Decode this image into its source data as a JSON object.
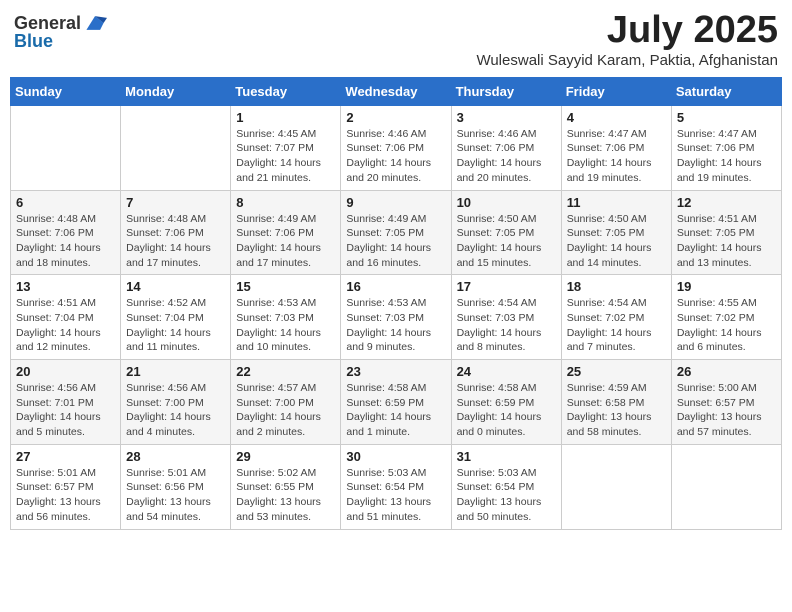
{
  "header": {
    "logo_general": "General",
    "logo_blue": "Blue",
    "title": "July 2025",
    "location": "Wuleswali Sayyid Karam, Paktia, Afghanistan"
  },
  "days_of_week": [
    "Sunday",
    "Monday",
    "Tuesday",
    "Wednesday",
    "Thursday",
    "Friday",
    "Saturday"
  ],
  "weeks": [
    [
      {
        "day": "",
        "detail": ""
      },
      {
        "day": "",
        "detail": ""
      },
      {
        "day": "1",
        "detail": "Sunrise: 4:45 AM\nSunset: 7:07 PM\nDaylight: 14 hours and 21 minutes."
      },
      {
        "day": "2",
        "detail": "Sunrise: 4:46 AM\nSunset: 7:06 PM\nDaylight: 14 hours and 20 minutes."
      },
      {
        "day": "3",
        "detail": "Sunrise: 4:46 AM\nSunset: 7:06 PM\nDaylight: 14 hours and 20 minutes."
      },
      {
        "day": "4",
        "detail": "Sunrise: 4:47 AM\nSunset: 7:06 PM\nDaylight: 14 hours and 19 minutes."
      },
      {
        "day": "5",
        "detail": "Sunrise: 4:47 AM\nSunset: 7:06 PM\nDaylight: 14 hours and 19 minutes."
      }
    ],
    [
      {
        "day": "6",
        "detail": "Sunrise: 4:48 AM\nSunset: 7:06 PM\nDaylight: 14 hours and 18 minutes."
      },
      {
        "day": "7",
        "detail": "Sunrise: 4:48 AM\nSunset: 7:06 PM\nDaylight: 14 hours and 17 minutes."
      },
      {
        "day": "8",
        "detail": "Sunrise: 4:49 AM\nSunset: 7:06 PM\nDaylight: 14 hours and 17 minutes."
      },
      {
        "day": "9",
        "detail": "Sunrise: 4:49 AM\nSunset: 7:05 PM\nDaylight: 14 hours and 16 minutes."
      },
      {
        "day": "10",
        "detail": "Sunrise: 4:50 AM\nSunset: 7:05 PM\nDaylight: 14 hours and 15 minutes."
      },
      {
        "day": "11",
        "detail": "Sunrise: 4:50 AM\nSunset: 7:05 PM\nDaylight: 14 hours and 14 minutes."
      },
      {
        "day": "12",
        "detail": "Sunrise: 4:51 AM\nSunset: 7:05 PM\nDaylight: 14 hours and 13 minutes."
      }
    ],
    [
      {
        "day": "13",
        "detail": "Sunrise: 4:51 AM\nSunset: 7:04 PM\nDaylight: 14 hours and 12 minutes."
      },
      {
        "day": "14",
        "detail": "Sunrise: 4:52 AM\nSunset: 7:04 PM\nDaylight: 14 hours and 11 minutes."
      },
      {
        "day": "15",
        "detail": "Sunrise: 4:53 AM\nSunset: 7:03 PM\nDaylight: 14 hours and 10 minutes."
      },
      {
        "day": "16",
        "detail": "Sunrise: 4:53 AM\nSunset: 7:03 PM\nDaylight: 14 hours and 9 minutes."
      },
      {
        "day": "17",
        "detail": "Sunrise: 4:54 AM\nSunset: 7:03 PM\nDaylight: 14 hours and 8 minutes."
      },
      {
        "day": "18",
        "detail": "Sunrise: 4:54 AM\nSunset: 7:02 PM\nDaylight: 14 hours and 7 minutes."
      },
      {
        "day": "19",
        "detail": "Sunrise: 4:55 AM\nSunset: 7:02 PM\nDaylight: 14 hours and 6 minutes."
      }
    ],
    [
      {
        "day": "20",
        "detail": "Sunrise: 4:56 AM\nSunset: 7:01 PM\nDaylight: 14 hours and 5 minutes."
      },
      {
        "day": "21",
        "detail": "Sunrise: 4:56 AM\nSunset: 7:00 PM\nDaylight: 14 hours and 4 minutes."
      },
      {
        "day": "22",
        "detail": "Sunrise: 4:57 AM\nSunset: 7:00 PM\nDaylight: 14 hours and 2 minutes."
      },
      {
        "day": "23",
        "detail": "Sunrise: 4:58 AM\nSunset: 6:59 PM\nDaylight: 14 hours and 1 minute."
      },
      {
        "day": "24",
        "detail": "Sunrise: 4:58 AM\nSunset: 6:59 PM\nDaylight: 14 hours and 0 minutes."
      },
      {
        "day": "25",
        "detail": "Sunrise: 4:59 AM\nSunset: 6:58 PM\nDaylight: 13 hours and 58 minutes."
      },
      {
        "day": "26",
        "detail": "Sunrise: 5:00 AM\nSunset: 6:57 PM\nDaylight: 13 hours and 57 minutes."
      }
    ],
    [
      {
        "day": "27",
        "detail": "Sunrise: 5:01 AM\nSunset: 6:57 PM\nDaylight: 13 hours and 56 minutes."
      },
      {
        "day": "28",
        "detail": "Sunrise: 5:01 AM\nSunset: 6:56 PM\nDaylight: 13 hours and 54 minutes."
      },
      {
        "day": "29",
        "detail": "Sunrise: 5:02 AM\nSunset: 6:55 PM\nDaylight: 13 hours and 53 minutes."
      },
      {
        "day": "30",
        "detail": "Sunrise: 5:03 AM\nSunset: 6:54 PM\nDaylight: 13 hours and 51 minutes."
      },
      {
        "day": "31",
        "detail": "Sunrise: 5:03 AM\nSunset: 6:54 PM\nDaylight: 13 hours and 50 minutes."
      },
      {
        "day": "",
        "detail": ""
      },
      {
        "day": "",
        "detail": ""
      }
    ]
  ]
}
